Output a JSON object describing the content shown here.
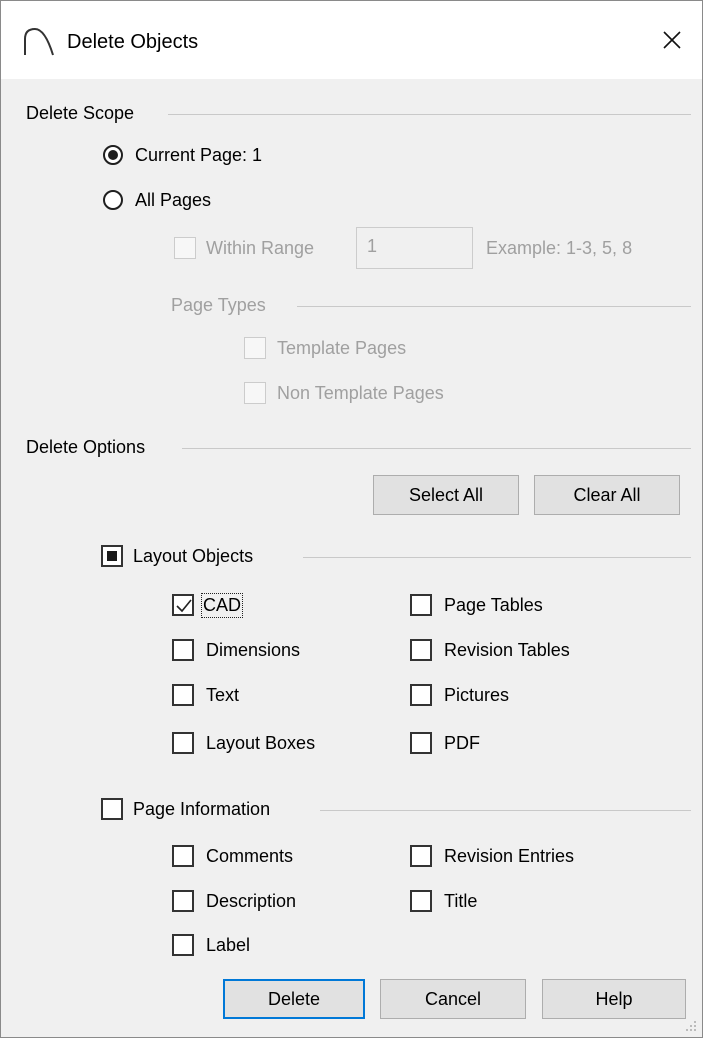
{
  "window": {
    "title": "Delete Objects"
  },
  "scope": {
    "group_label": "Delete Scope",
    "current_page_label": "Current Page: 1",
    "all_pages_label": "All Pages",
    "within_range_label": "Within Range",
    "range_value": "1",
    "range_example": "Example: 1-3, 5, 8",
    "page_types_label": "Page Types",
    "template_pages_label": "Template Pages",
    "non_template_pages_label": "Non Template Pages",
    "selected": "current_page"
  },
  "options": {
    "group_label": "Delete Options",
    "select_all_label": "Select All",
    "clear_all_label": "Clear All",
    "layout_objects": {
      "label": "Layout Objects",
      "state": "indeterminate",
      "items": [
        {
          "label": "CAD",
          "checked": true
        },
        {
          "label": "Dimensions",
          "checked": false
        },
        {
          "label": "Text",
          "checked": false
        },
        {
          "label": "Layout Boxes",
          "checked": false
        },
        {
          "label": "Page Tables",
          "checked": false
        },
        {
          "label": "Revision Tables",
          "checked": false
        },
        {
          "label": "Pictures",
          "checked": false
        },
        {
          "label": "PDF",
          "checked": false
        }
      ]
    },
    "page_information": {
      "label": "Page Information",
      "state": "unchecked",
      "items": [
        {
          "label": "Comments",
          "checked": false
        },
        {
          "label": "Description",
          "checked": false
        },
        {
          "label": "Label",
          "checked": false
        },
        {
          "label": "Revision Entries",
          "checked": false
        },
        {
          "label": "Title",
          "checked": false
        }
      ]
    }
  },
  "buttons": {
    "delete": "Delete",
    "cancel": "Cancel",
    "help": "Help"
  },
  "colors": {
    "default_button_border": "#0078d7",
    "disabled_text": "#a0a0a0"
  }
}
